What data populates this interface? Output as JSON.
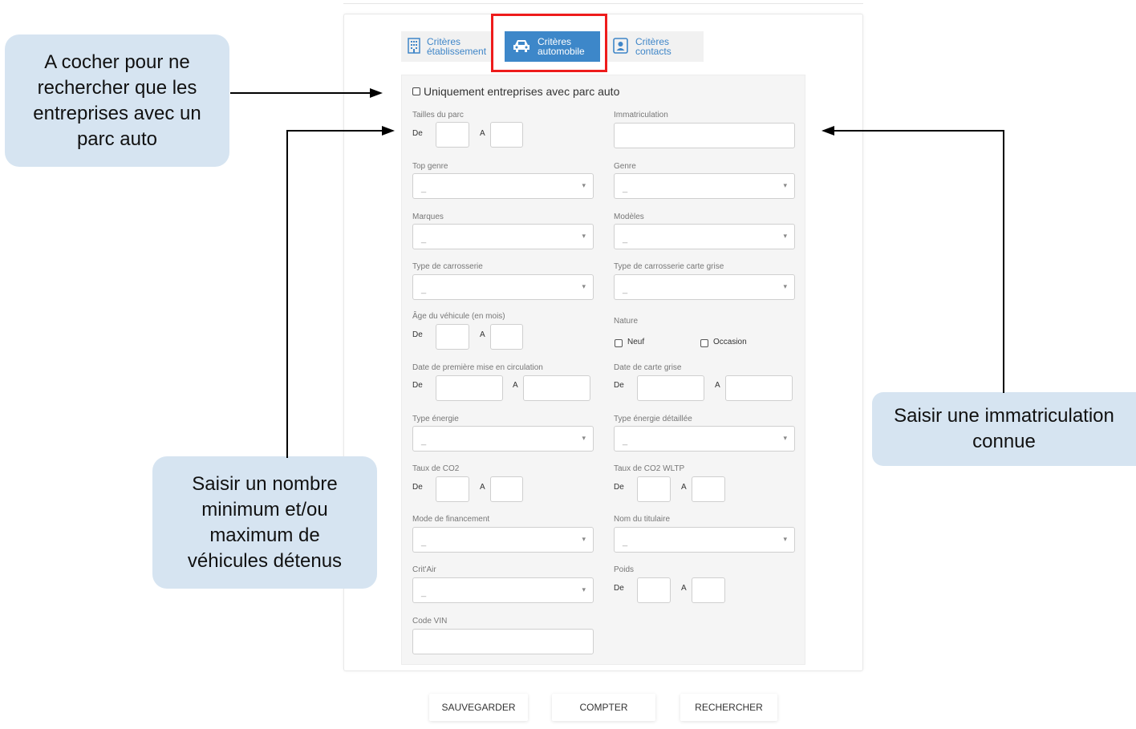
{
  "tabs": [
    {
      "line1": "Critères",
      "line2": "établissement"
    },
    {
      "line1": "Critères",
      "line2": "automobile"
    },
    {
      "line1": "Critères",
      "line2": "contacts"
    }
  ],
  "only_with_fleet": "Uniquement entreprises avec parc auto",
  "range_from": "De",
  "range_to": "A",
  "select_empty": "_",
  "fields": {
    "fleet_size": "Tailles du parc",
    "registration": "Immatriculation",
    "top_genre": "Top genre",
    "genre": "Genre",
    "brands": "Marques",
    "models": "Modèles",
    "body_type": "Type de carrosserie",
    "body_type_registration": "Type de carrosserie carte grise",
    "vehicle_age": "Âge du véhicule (en mois)",
    "nature": "Nature",
    "nature_new": "Neuf",
    "nature_used": "Occasion",
    "first_registration_date": "Date de première mise en circulation",
    "registration_card_date": "Date de carte grise",
    "energy_type": "Type énergie",
    "energy_type_detailed": "Type énergie détaillée",
    "co2": "Taux de CO2",
    "co2_wltp": "Taux de CO2 WLTP",
    "financing": "Mode de financement",
    "holder_name": "Nom du titulaire",
    "critair": "Crit'Air",
    "weight": "Poids",
    "vin": "Code VIN"
  },
  "buttons": {
    "save": "SAUVEGARDER",
    "count": "COMPTER",
    "search": "RECHERCHER"
  },
  "callouts": {
    "checkbox_note": "A cocher pour ne rechercher que les entreprises avec un parc auto",
    "fleet_note": "Saisir un nombre minimum et/ou maximum de véhicules détenus",
    "registration_note": "Saisir une immatriculation connue"
  },
  "colors": {
    "accent": "#3d87c9",
    "highlight": "#ee1c1c",
    "callout_bg": "#d6e4f1"
  }
}
